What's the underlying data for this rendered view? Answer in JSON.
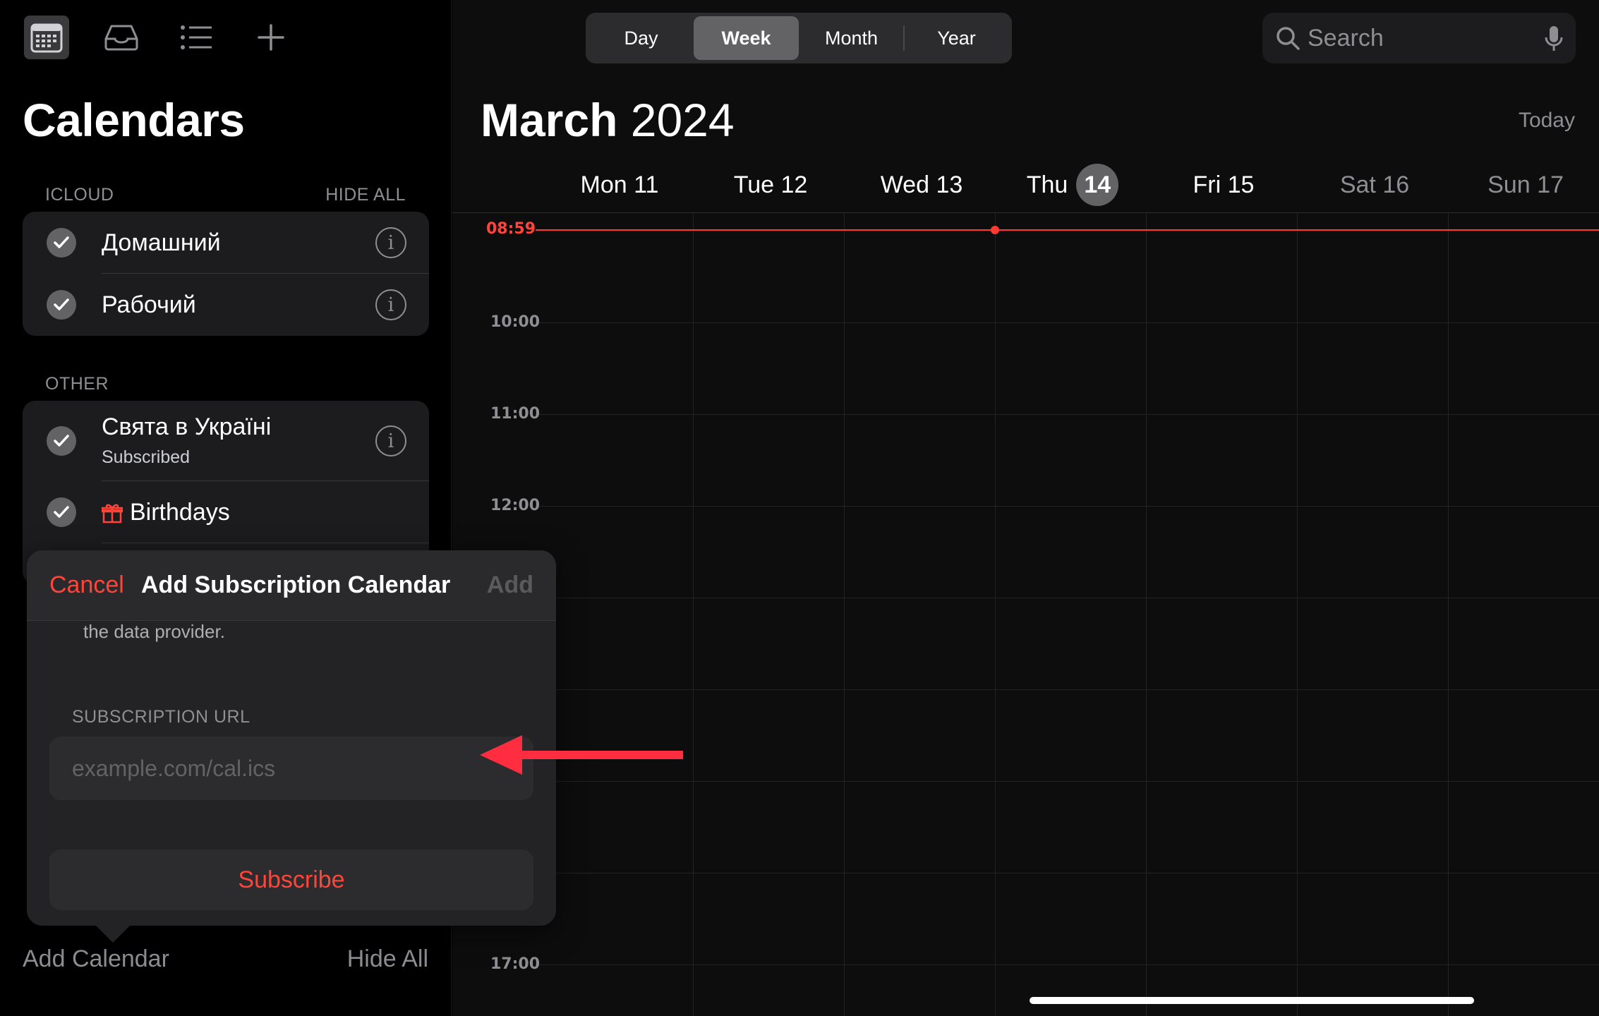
{
  "toolbar": {
    "calendar_icon": "calendar-grid-icon",
    "inbox_icon": "inbox-tray-icon",
    "list_icon": "list-icon",
    "add_icon": "plus-icon"
  },
  "sidebar": {
    "title": "Calendars",
    "icloud": {
      "header": "ICLOUD",
      "action": "HIDE ALL",
      "items": [
        {
          "label": "Домашний"
        },
        {
          "label": "Рабочий"
        }
      ]
    },
    "other": {
      "header": "OTHER",
      "items": [
        {
          "label": "Свята в Україні",
          "sub": "Subscribed"
        },
        {
          "label": "Birthdays"
        }
      ]
    },
    "add_calendar": "Add Calendar",
    "hide_all": "Hide All"
  },
  "view_switch": {
    "items": [
      "Day",
      "Week",
      "Month",
      "Year"
    ],
    "selected": "Week"
  },
  "search": {
    "placeholder": "Search"
  },
  "header": {
    "month": "March",
    "year": "2024",
    "today": "Today"
  },
  "week": {
    "days": [
      {
        "name": "Mon",
        "num": "11"
      },
      {
        "name": "Tue",
        "num": "12"
      },
      {
        "name": "Wed",
        "num": "13"
      },
      {
        "name": "Thu",
        "num": "14"
      },
      {
        "name": "Fri",
        "num": "15"
      },
      {
        "name": "Sat",
        "num": "16"
      },
      {
        "name": "Sun",
        "num": "17"
      }
    ],
    "now_time": "08:59",
    "hours": [
      "10:00",
      "11:00",
      "12:00",
      "17:00"
    ]
  },
  "popover": {
    "cancel": "Cancel",
    "title": "Add Subscription Calendar",
    "add": "Add",
    "note": "the data provider.",
    "url_header": "SUBSCRIPTION URL",
    "url_placeholder": "example.com/cal.ics",
    "url_value": "",
    "subscribe": "Subscribe"
  },
  "colors": {
    "accent": "#ff453a",
    "now_line": "#ff3b30",
    "annotation_arrow": "#ff2d3f"
  }
}
